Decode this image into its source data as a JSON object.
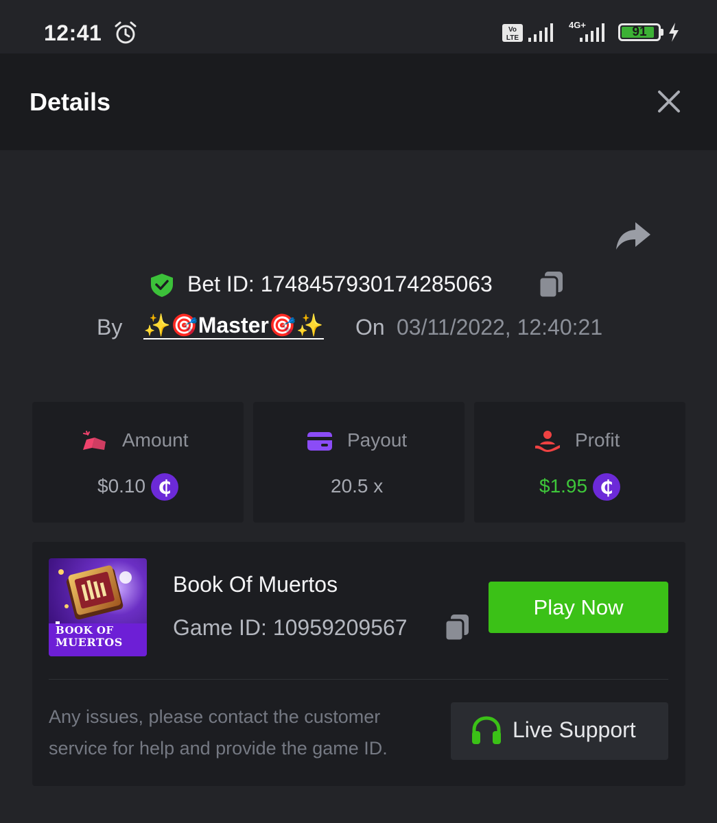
{
  "status_bar": {
    "time": "12:41",
    "network_label": "4G+",
    "battery_level": 91,
    "battery_text": "91",
    "icons": [
      "alarm-icon",
      "volte-icon",
      "signal-icon",
      "signal-icon",
      "battery-icon",
      "charging-bolt-icon"
    ]
  },
  "header": {
    "title": "Details",
    "close_icon": "close-icon"
  },
  "share": {
    "icon": "share-arrow-icon"
  },
  "bet": {
    "id_label": "Bet ID: 1748457930174285063",
    "verified_icon": "shield-check-icon",
    "copy_icon": "copy-icon",
    "by_label": "By",
    "user": "✨🎯Master🎯✨",
    "on_label": "On",
    "datetime": "03/11/2022, 12:40:21"
  },
  "stats": {
    "amount": {
      "label": "Amount",
      "value": "$0.10",
      "icon": "cash-icon",
      "currency_icon": "coin-icon"
    },
    "payout": {
      "label": "Payout",
      "value": "20.5 x",
      "icon": "wallet-card-icon"
    },
    "profit": {
      "label": "Profit",
      "value": "$1.95",
      "icon": "hand-coin-icon",
      "currency_icon": "coin-icon"
    }
  },
  "game": {
    "name": "Book Of Muertos",
    "id_label": "Game ID: 10959209567",
    "thumb_text_line1": "BOOK OF",
    "thumb_text_line2": "MUERTOS",
    "play_label": "Play Now"
  },
  "support": {
    "help_text": "Any issues, please contact the customer service for help and provide the game ID.",
    "button_label": "Live Support",
    "icon": "headset-icon"
  },
  "colors": {
    "background": "#232428",
    "header": "#1a1b1e",
    "card": "#1c1d21",
    "accent_green": "#3bc117",
    "profit_green": "#3ec73a",
    "coin_purple": "#6c2ad8",
    "amount_icon": "#f0436d",
    "payout_icon": "#8b4cf6",
    "profit_icon": "#ef4242"
  }
}
